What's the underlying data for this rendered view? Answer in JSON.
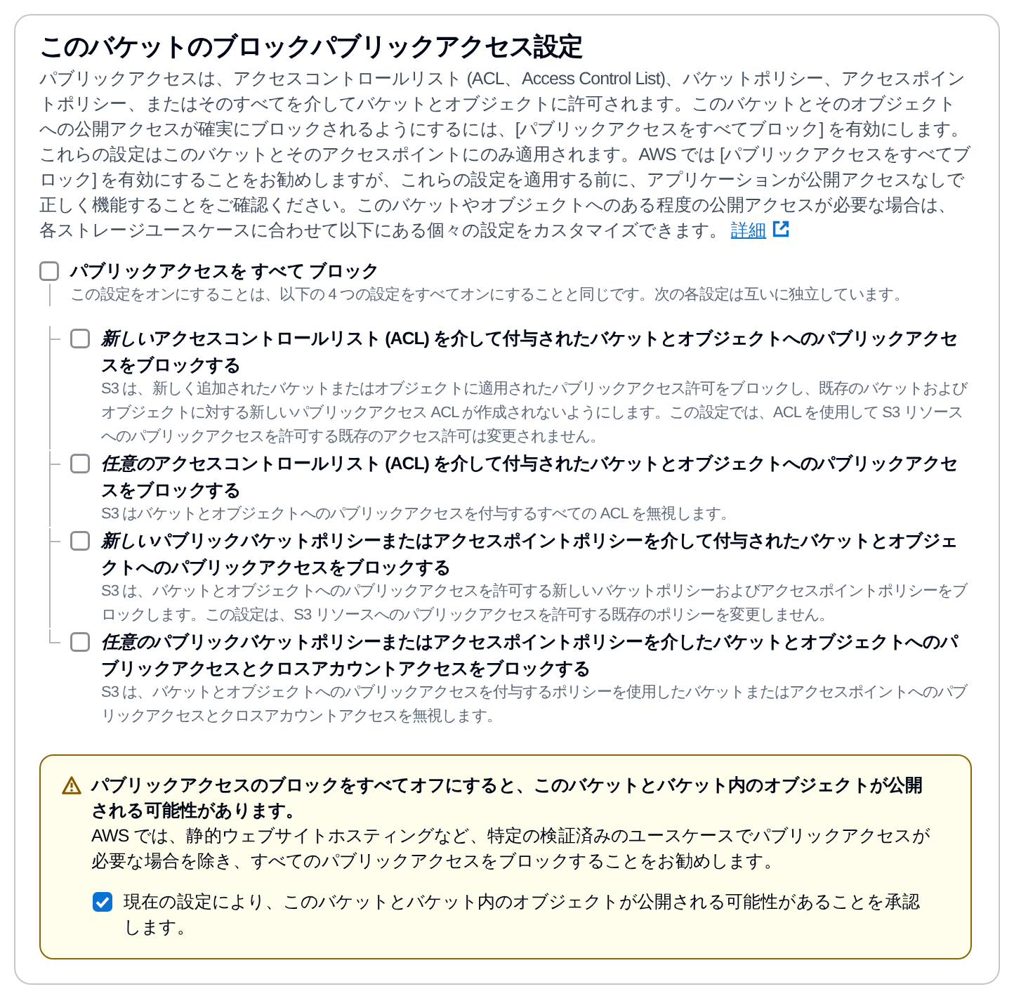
{
  "section": {
    "title": "このバケットのブロックパブリックアクセス設定",
    "description": "パブリックアクセスは、アクセスコントロールリスト (ACL、Access Control List)、バケットポリシー、アクセスポイントポリシー、またはそのすべてを介してバケットとオブジェクトに許可されます。このバケットとそのオブジェクトへの公開アクセスが確実にブロックされるようにするには、[パブリックアクセスをすべてブロック] を有効にします。これらの設定はこのバケットとそのアクセスポイントにのみ適用されます。AWS では [パブリックアクセスをすべてブロック] を有効にすることをお勧めしますが、これらの設定を適用する前に、アプリケーションが公開アクセスなしで正しく機能することをご確認ください。このバケットやオブジェクトへのある程度の公開アクセスが必要な場合は、各ストレージユースケースに合わせて以下にある個々の設定をカスタマイズできます。",
    "link": "詳細"
  },
  "block_all": {
    "label": "パブリックアクセスを すべて ブロック",
    "description": "この設定をオンにすることは、以下の 4 つの設定をすべてオンにすることと同じです。次の各設定は互いに独立しています。",
    "checked": false
  },
  "settings": [
    {
      "emphasis": "新しい",
      "label": "アクセスコントロールリスト (ACL) を介して付与されたバケットとオブジェクトへのパブリックアクセスをブロックする",
      "description": "S3 は、新しく追加されたバケットまたはオブジェクトに適用されたパブリックアクセス許可をブロックし、既存のバケットおよびオブジェクトに対する新しいパブリックアクセス ACL が作成されないようにします。この設定では、ACL を使用して S3 リソースへのパブリックアクセスを許可する既存のアクセス許可は変更されません。",
      "checked": false
    },
    {
      "emphasis": "任意の",
      "label": "アクセスコントロールリスト (ACL) を介して付与されたバケットとオブジェクトへのパブリックアクセスをブロックする",
      "description": "S3 はバケットとオブジェクトへのパブリックアクセスを付与するすべての ACL を無視します。",
      "checked": false
    },
    {
      "emphasis": "新しい",
      "label": "パブリックバケットポリシーまたはアクセスポイントポリシーを介して付与されたバケットとオブジェクトへのパブリックアクセスをブロックする",
      "description": "S3 は、バケットとオブジェクトへのパブリックアクセスを許可する新しいバケットポリシーおよびアクセスポイントポリシーをブロックします。この設定は、S3 リソースへのパブリックアクセスを許可する既存のポリシーを変更しません。",
      "checked": false
    },
    {
      "emphasis": "任意の",
      "label": "パブリックバケットポリシーまたはアクセスポイントポリシーを介したバケットとオブジェクトへのパブリックアクセスとクロスアカウントアクセスをブロックする",
      "description": "S3 は、バケットとオブジェクトへのパブリックアクセスを付与するポリシーを使用したバケットまたはアクセスポイントへのパブリックアクセスとクロスアカウントアクセスを無視します。",
      "checked": false
    }
  ],
  "warning": {
    "title": "パブリックアクセスのブロックをすべてオフにすると、このバケットとバケット内のオブジェクトが公開される可能性があります。",
    "description": "AWS では、静的ウェブサイトホスティングなど、特定の検証済みのユースケースでパブリックアクセスが必要な場合を除き、すべてのパブリックアクセスをブロックすることをお勧めします。",
    "acknowledge": {
      "label": "現在の設定により、このバケットとバケット内のオブジェクトが公開される可能性があることを承認します。",
      "checked": true
    }
  }
}
